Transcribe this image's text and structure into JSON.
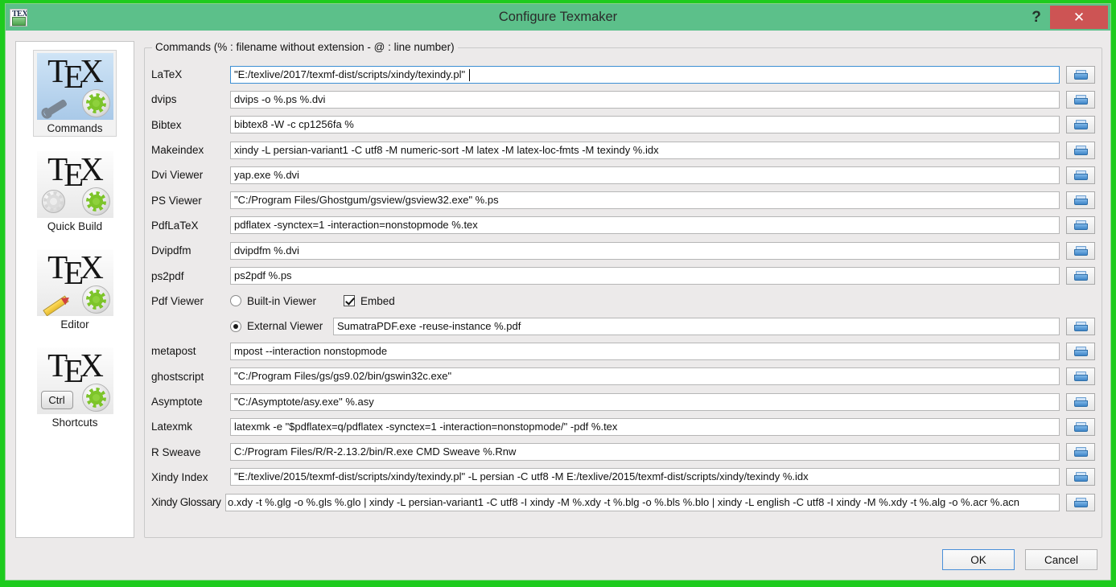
{
  "window": {
    "title": "Configure Texmaker",
    "help_label": "?",
    "close_label": "✕",
    "app_icon_top": "TEX",
    "frame_color": "#1ecb1e",
    "titlebar_color": "#5cc08a",
    "close_color": "#cd5454"
  },
  "sidebar": {
    "items": [
      {
        "label": "Commands",
        "selected": true
      },
      {
        "label": "Quick Build",
        "selected": false
      },
      {
        "label": "Editor",
        "selected": false
      },
      {
        "label": "Shortcuts",
        "selected": false
      }
    ]
  },
  "main": {
    "group_title": "Commands (% : filename without extension - @ : line number)",
    "rows": [
      {
        "label": "LaTeX",
        "value": "\"E:/texlive/2017/texmf-dist/scripts/xindy/texindy.pl\"",
        "focused": true
      },
      {
        "label": "dvips",
        "value": "dvips -o %.ps %.dvi",
        "focused": false
      },
      {
        "label": "Bibtex",
        "value": "bibtex8 -W -c cp1256fa %",
        "focused": false
      },
      {
        "label": "Makeindex",
        "value": "xindy -L persian-variant1 -C utf8 -M numeric-sort -M latex -M latex-loc-fmts -M texindy %.idx",
        "focused": false
      },
      {
        "label": "Dvi Viewer",
        "value": "yap.exe %.dvi",
        "focused": false
      },
      {
        "label": "PS Viewer",
        "value": "\"C:/Program Files/Ghostgum/gsview/gsview32.exe\" %.ps",
        "focused": false
      },
      {
        "label": "PdfLaTeX",
        "value": "pdflatex -synctex=1 -interaction=nonstopmode %.tex",
        "focused": false
      },
      {
        "label": "Dvipdfm",
        "value": "dvipdfm %.dvi",
        "focused": false
      },
      {
        "label": "ps2pdf",
        "value": "ps2pdf %.ps",
        "focused": false
      }
    ],
    "pdf_viewer": {
      "label": "Pdf Viewer",
      "builtin_label": "Built-in Viewer",
      "builtin_selected": false,
      "embed_label": "Embed",
      "embed_checked": true,
      "external_label": "External Viewer",
      "external_selected": true,
      "external_value": "SumatraPDF.exe -reuse-instance %.pdf"
    },
    "rows2": [
      {
        "label": "metapost",
        "value": "mpost --interaction nonstopmode",
        "focused": false
      },
      {
        "label": "ghostscript",
        "value": "\"C:/Program Files/gs/gs9.02/bin/gswin32c.exe\"",
        "focused": false
      },
      {
        "label": "Asymptote",
        "value": "\"C:/Asymptote/asy.exe\" %.asy",
        "focused": false
      },
      {
        "label": "Latexmk",
        "value": "latexmk -e \"$pdflatex=q/pdflatex -synctex=1 -interaction=nonstopmode/\" -pdf %.tex",
        "focused": false
      },
      {
        "label": "R Sweave",
        "value": "C:/Program Files/R/R-2.13.2/bin/R.exe CMD Sweave %.Rnw",
        "focused": false
      },
      {
        "label": "Xindy Index",
        "value": "\"E:/texlive/2015/texmf-dist/scripts/xindy/texindy.pl\" -L persian -C utf8 -M E:/texlive/2015/texmf-dist/scripts/xindy/texindy %.idx",
        "focused": false
      },
      {
        "label": "Xindy Glossary",
        "value": "o.xdy -t %.glg -o %.gls %.glo  |  xindy -L persian-variant1 -C utf8 -I xindy -M %.xdy -t %.blg -o %.bls %.blo  |  xindy -L english -C utf8 -I xindy -M %.xdy -t %.alg -o %.acr %.acn",
        "focused": false
      }
    ]
  },
  "footer": {
    "ok_label": "OK",
    "cancel_label": "Cancel"
  }
}
